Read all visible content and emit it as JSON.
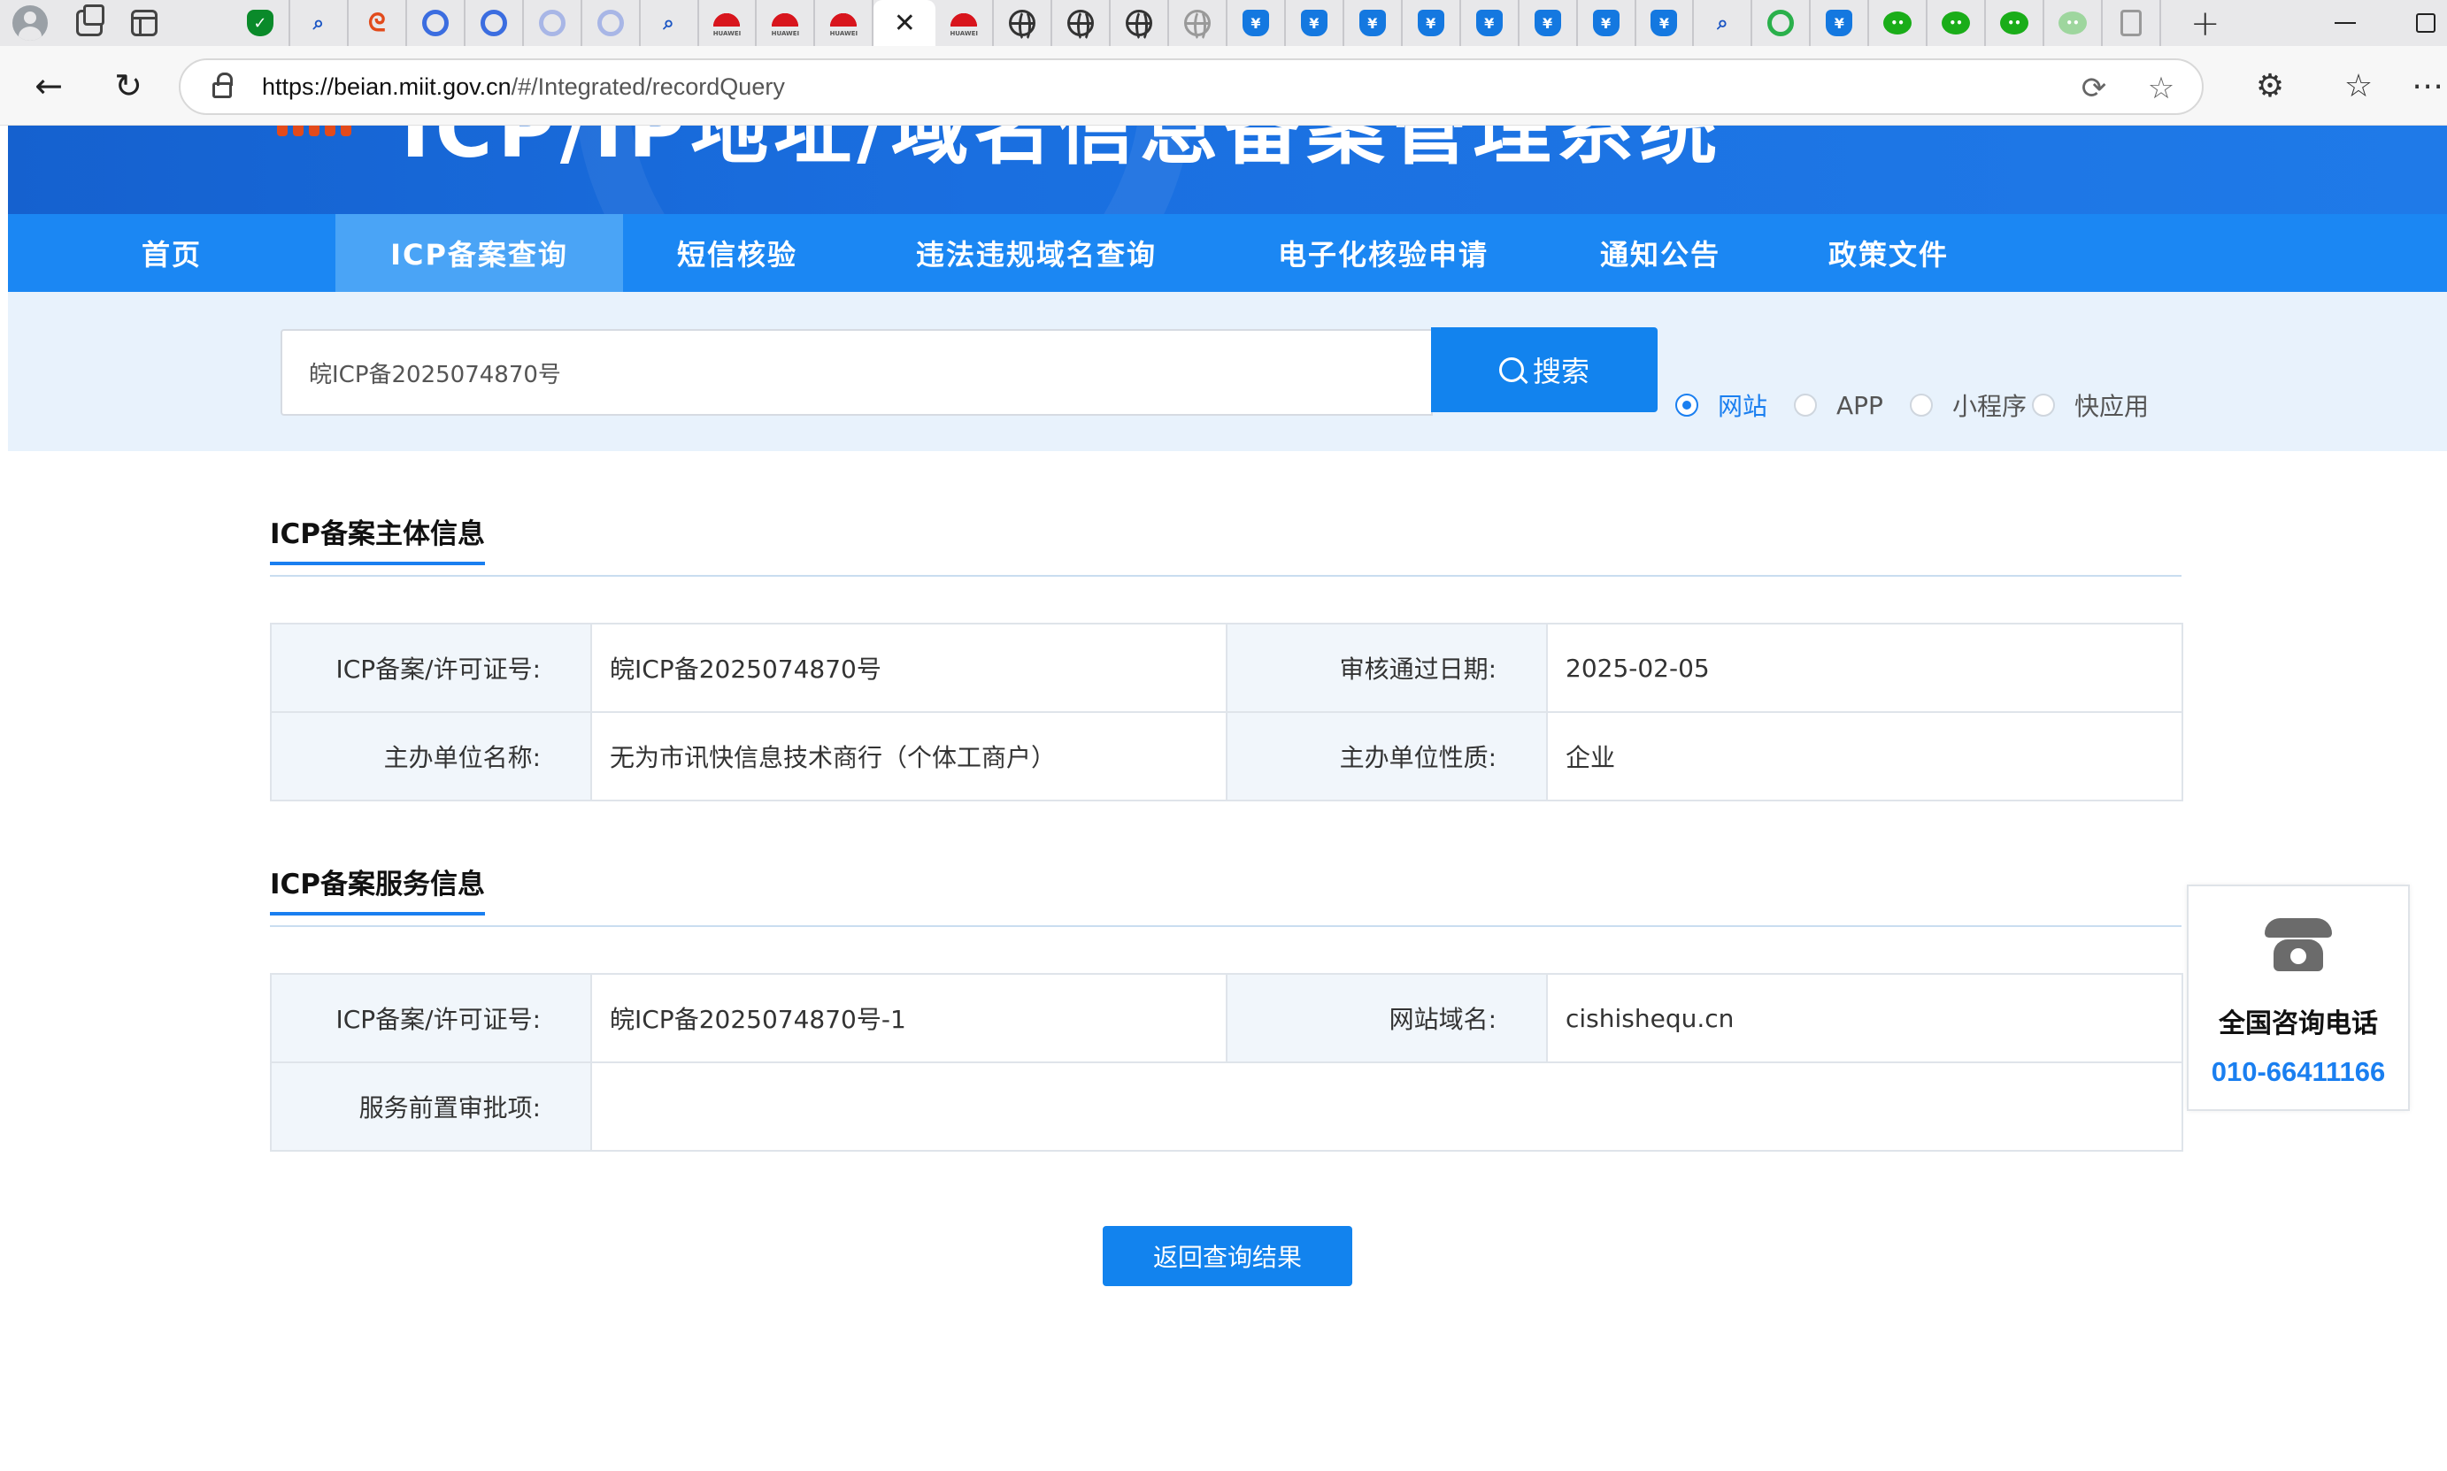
{
  "browser": {
    "url_host": "https://beian.miit.gov.cn",
    "url_path": "/#/Integrated/recordQuery"
  },
  "site": {
    "title": "ICP/IP地址/域名信息备案管理系统",
    "nav": [
      {
        "label": "首页",
        "active": false
      },
      {
        "label": "ICP备案查询",
        "active": true
      },
      {
        "label": "短信核验",
        "active": false
      },
      {
        "label": "违法违规域名查询",
        "active": false
      },
      {
        "label": "电子化核验申请",
        "active": false
      },
      {
        "label": "通知公告",
        "active": false
      },
      {
        "label": "政策文件",
        "active": false
      }
    ]
  },
  "search": {
    "value": "皖ICP备2025074870号",
    "button_label": "搜索",
    "types": [
      {
        "label": "网站",
        "checked": true
      },
      {
        "label": "APP",
        "checked": false
      },
      {
        "label": "小程序",
        "checked": false
      },
      {
        "label": "快应用",
        "checked": false
      }
    ]
  },
  "subject": {
    "title": "ICP备案主体信息",
    "license_label": "ICP备案/许可证号:",
    "license_value": "皖ICP备2025074870号",
    "date_label": "审核通过日期:",
    "date_value": "2025-02-05",
    "org_label": "主办单位名称:",
    "org_value": "无为市讯快信息技术商行（个体工商户）",
    "nature_label": "主办单位性质:",
    "nature_value": "企业"
  },
  "service": {
    "title": "ICP备案服务信息",
    "license_label": "ICP备案/许可证号:",
    "license_value": "皖ICP备2025074870号-1",
    "domain_label": "网站域名:",
    "domain_value": "cishishequ.cn",
    "approval_label": "服务前置审批项:",
    "approval_value": ""
  },
  "back_button": "返回查询结果",
  "contact": {
    "title": "全国咨询电话",
    "phone": "010-66411166"
  },
  "colors": {
    "primary": "#1a7ff0",
    "nav_bg": "#1b87f3",
    "search_band": "#e8f2fc"
  }
}
